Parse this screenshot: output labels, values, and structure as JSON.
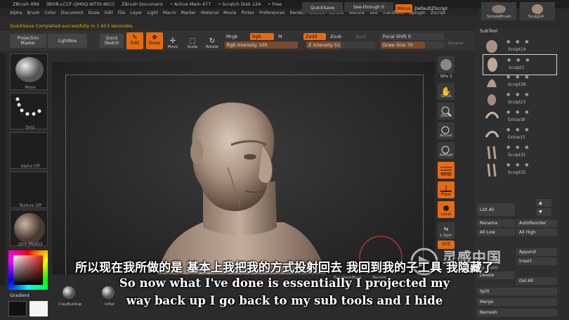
{
  "titlebar": {
    "app": "ZBrush 4R6",
    "doc_id": "[BIVR-LCCF-QHHQ-WTOI-NICI]",
    "document": "ZBrush Document",
    "active_mem": "• Active Mem 477",
    "scratch_disk": "• Scratch Disk 124",
    "free": "• Free"
  },
  "menubar": {
    "items": [
      "Alpha",
      "Brush",
      "Color",
      "Document",
      "Draw",
      "Edit",
      "File",
      "Layer",
      "Light",
      "Macro",
      "Marker",
      "Material",
      "Movie",
      "Picker",
      "Preferences",
      "Render",
      "Stencil",
      "Stroke",
      "Texture",
      "Tool",
      "Transform",
      "Zplugin",
      "Zscript"
    ]
  },
  "topright": {
    "quicksave": "QuickSave",
    "seethrough": "See-through 0",
    "menus": "Menus",
    "default_zscript": "DefaultZScript",
    "thumb1_label": "SimpleBrush",
    "thumb2_label": "Sculp14"
  },
  "status": {
    "message": "QuickSave Completed successfully in 1.653 secondes."
  },
  "toolbar": {
    "projection_master": "Projection Master",
    "lightbox": "LightBox",
    "quick_sketch": "Quick Sketch",
    "edit": "Edit",
    "draw": "Draw",
    "move": "Move",
    "scale": "Scale",
    "rotate": "Rotate",
    "mrgb": "Mrgb",
    "rgb": "Rgb",
    "m": "M",
    "zadd": "Zadd",
    "zsub": "Zsub",
    "zcut": "Zcut",
    "rgb_intensity": "Rgb Intensity 100",
    "z_intensity": "Z Intensity 51",
    "focal_shift": "Focal Shift 0",
    "draw_size": "Draw Size 70",
    "dynamic": "Dynamic"
  },
  "progress": {
    "rgb_intensity": 100,
    "z_intensity": 51,
    "draw_size": 70
  },
  "leftshelf": {
    "move": "Move",
    "dots": "Dots",
    "alpha_off": "Alpha Off",
    "texture_off": "Texture Off",
    "material": "zbro_Mud03"
  },
  "rightbar": {
    "spix": "SPix 3",
    "scroll": "Scroll",
    "zoom": "Zoom",
    "actual": "Actual",
    "aahalf": "AAHalf",
    "persp": "Persp",
    "floor": "Floor",
    "local": "Local",
    "lsym": "L.Sym",
    "xyz": "XYZ"
  },
  "subtool": {
    "header": "SubTool",
    "items": [
      "Sculpt14",
      "Sculpt3",
      "Sculpt38",
      "Sculpt23",
      "Extract8",
      "Extract3",
      "Sculpt31",
      "Sculpt35"
    ],
    "list_all": "List All",
    "rename": "Rename",
    "auto_reorder": "AutoReorder",
    "all_low": "All Low",
    "all_high": "All High",
    "append": "Append",
    "insert": "Insert",
    "delete": "Delete",
    "del_all": "Del All",
    "split": "Split",
    "merge": "Merge",
    "remesh": "Remesh"
  },
  "bottom": {
    "brushes": [
      "ClayBuildup",
      "Inflat"
    ],
    "backface": "BackfaceMask",
    "record": "Record",
    "gradient": "Gradient"
  },
  "subtitles": {
    "cn": "所以现在我所做的是 基本上我把我的方式投射回去 我回到我的子工具 我隐藏了",
    "en_line1": "So now what I've done is essentially I projected my",
    "en_line2": "way back up I go back to my sub tools and I hide"
  },
  "watermark": {
    "cn": "灵感中国",
    "url": "lingganchina.com"
  },
  "colors": {
    "accent": "#e56a10",
    "skin": "#b8a596",
    "status": "#e6b300"
  }
}
